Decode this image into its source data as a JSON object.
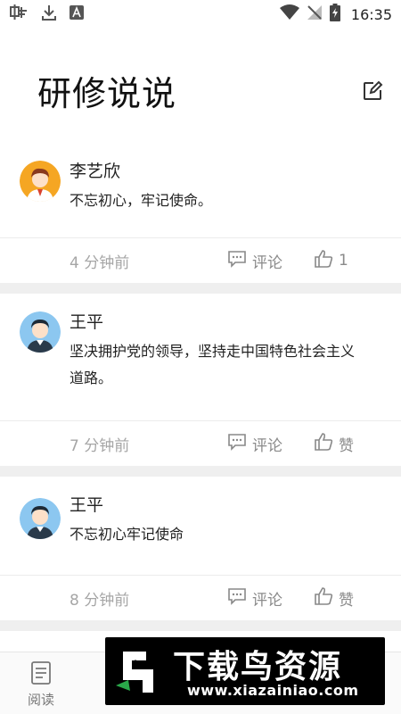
{
  "status_bar": {
    "time": "16:35"
  },
  "header": {
    "title": "研修说说"
  },
  "posts": [
    {
      "author": "李艺欣",
      "content": "不忘初心，牢记使命。",
      "time": "4 分钟前",
      "comment_label": "评论",
      "like_label": "1"
    },
    {
      "author": "王平",
      "content": "坚决拥护党的领导，坚持走中国特色社会主义道路。",
      "time": "7 分钟前",
      "comment_label": "评论",
      "like_label": "赞"
    },
    {
      "author": "王平",
      "content": "不忘初心牢记使命",
      "time": "8 分钟前",
      "comment_label": "评论",
      "like_label": "赞"
    }
  ],
  "bottom_nav": {
    "items": [
      {
        "label": "阅读"
      }
    ]
  },
  "watermark": {
    "title": "下载鸟资源",
    "url": "www.xiazainiao.com"
  },
  "colors": {
    "divider": "#efefef",
    "muted_text": "#a6a6a6",
    "avatar_orange": "#f5a623",
    "avatar_blue": "#8cc7f0"
  }
}
